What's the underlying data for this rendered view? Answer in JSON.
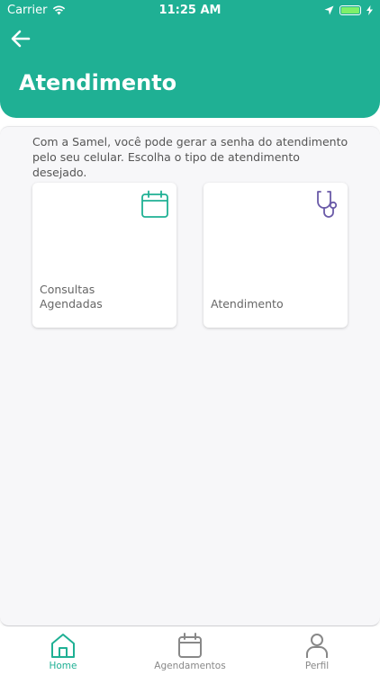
{
  "status_bar": {
    "carrier": "Carrier",
    "time": "11:25 AM",
    "icons": [
      "wifi-icon",
      "location-icon",
      "battery-icon",
      "charging-icon"
    ]
  },
  "header": {
    "title": "Atendimento",
    "back_icon": "arrow-left-icon",
    "color": "#1fb094"
  },
  "main": {
    "intro_text": "Com a Samel, você pode gerar a senha do atendimento pelo seu celular. Escolha o tipo de atendimento desejado.",
    "cards": [
      {
        "line1": "Consultas",
        "line2": "Agendadas",
        "icon": "calendar-icon",
        "icon_color": "#1fb094"
      },
      {
        "line1": "",
        "line2": "Atendimento",
        "icon": "stethoscope-icon",
        "icon_color": "#6a5aa8"
      }
    ]
  },
  "tab_bar": {
    "tabs": [
      {
        "label": "Home",
        "icon": "home-icon",
        "active": true
      },
      {
        "label": "Agendamentos",
        "icon": "calendar-icon",
        "active": false
      },
      {
        "label": "Perfil",
        "icon": "user-icon",
        "active": false
      }
    ],
    "active_color": "#1fb094",
    "inactive_color": "#888888"
  }
}
